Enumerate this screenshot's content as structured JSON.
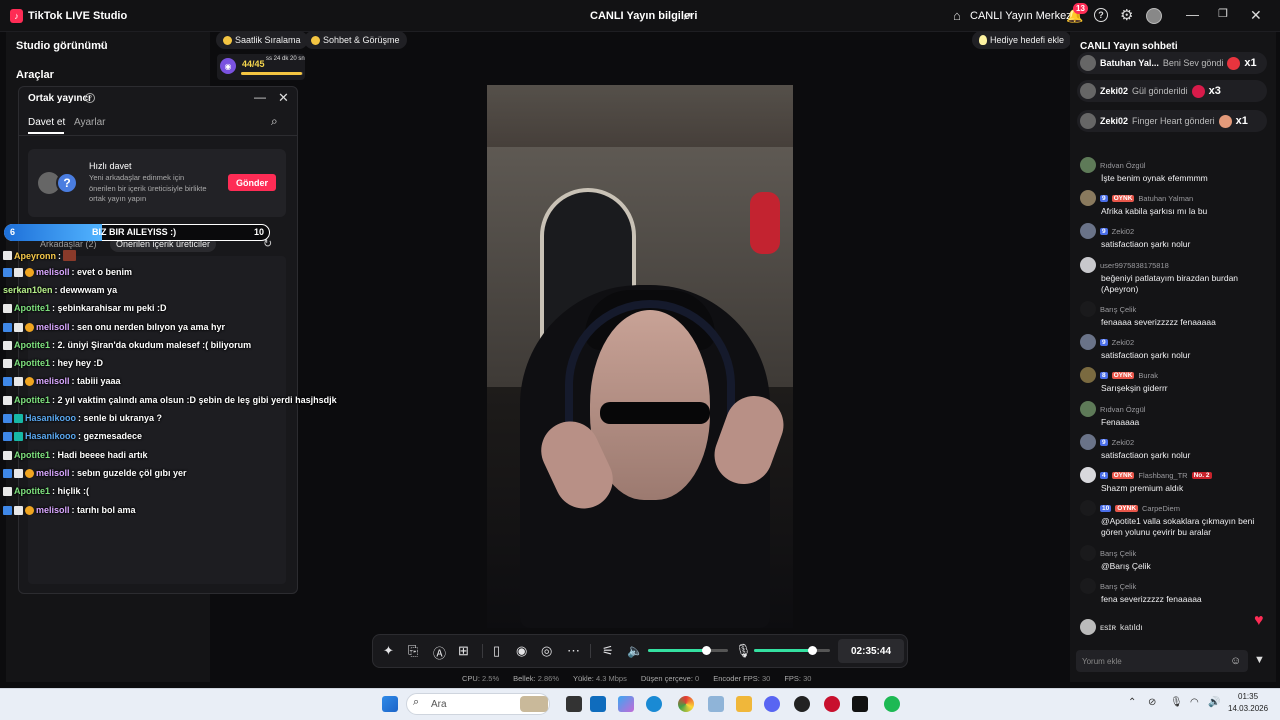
{
  "titlebar": {
    "app_title": "TikTok LIVE Studio",
    "live_info": "CANLI Yayın bilgileri",
    "live_center": "CANLI Yayın Merkezi",
    "notifications_count": "13"
  },
  "left": {
    "studio_view": "Studio görünümü",
    "tools": "Araçlar"
  },
  "pills": {
    "ranking": "Saatlik Sıralama",
    "chat_call": "Sohbet & Görüşme",
    "gift_goal": "Hediye hedefi ekle"
  },
  "goal": {
    "count": "44/45",
    "timer": "ss 24 dk 20 sn",
    "progress": 0.977
  },
  "cohost": {
    "title": "Ortak yayıncı",
    "tab_invite": "Davet et",
    "tab_settings": "Ayarlar",
    "quick_title": "Hızlı davet",
    "quick_desc": "Yeni arkadaşlar edinmek için önerilen bir içerik üreticisiyle birlikte ortak yayın yapın",
    "send": "Gönder",
    "friends_tab": "Arkadaşlar (2)",
    "suggested_tab": "Önerilen içerik üreticiler"
  },
  "score": {
    "left": "6",
    "team": "BIZ BIR AILEYISS :)",
    "right": "10",
    "left_share": 0.37
  },
  "overlay_chat": [
    {
      "name": "Apeyronn",
      "text": ":",
      "color": "gold",
      "badges": [
        "white"
      ],
      "flag": true
    },
    {
      "name": "melisoll",
      "text": ": evet o benim",
      "color": "pink",
      "badges": [
        "blue",
        "white",
        "orange"
      ]
    },
    {
      "name": "serkan10en",
      "text": ": dewwwam ya",
      "color": "lime",
      "badges": []
    },
    {
      "name": "Apotite1",
      "text": ": şebinkarahisar mı peki :D",
      "color": "green",
      "badges": [
        "white"
      ]
    },
    {
      "name": "melisoll",
      "text": ": sen onu nerden bılıyon ya ama hyr",
      "color": "pink",
      "badges": [
        "blue",
        "white",
        "orange"
      ]
    },
    {
      "name": "Apotite1",
      "text": ": 2. üniyi Şiran'da okudum malesef :( biliyorum",
      "color": "green",
      "badges": [
        "white"
      ]
    },
    {
      "name": "Apotite1",
      "text": ": hey hey :D",
      "color": "green",
      "badges": [
        "white"
      ]
    },
    {
      "name": "melisoll",
      "text": ": tabiii yaaa",
      "color": "pink",
      "badges": [
        "blue",
        "white",
        "orange"
      ]
    },
    {
      "name": "Apotite1",
      "text": ": 2 yıl vaktim çalındı ama olsun :D şebin de leş gibi yerdi hasjhsdjk",
      "color": "green",
      "badges": [
        "white"
      ]
    },
    {
      "name": "Hasanikooo",
      "text": ": senle bi ukranya ?",
      "color": "blue",
      "badges": [
        "blue",
        "teal"
      ]
    },
    {
      "name": "Hasanikooo",
      "text": ": gezmesadece",
      "color": "blue",
      "badges": [
        "blue",
        "teal"
      ]
    },
    {
      "name": "Apotite1",
      "text": ": Hadi beeee hadi artık",
      "color": "green",
      "badges": [
        "white"
      ]
    },
    {
      "name": "melisoll",
      "text": ": sebın guzelde çöl gıbı yer",
      "color": "pink",
      "badges": [
        "blue",
        "white",
        "orange"
      ]
    },
    {
      "name": "Apotite1",
      "text": ": hiçlik :(",
      "color": "green",
      "badges": [
        "white"
      ]
    },
    {
      "name": "melisoll",
      "text": ": tarıhı bol ama",
      "color": "pink",
      "badges": [
        "blue",
        "white",
        "orange"
      ]
    }
  ],
  "toolbar": {
    "timer": "02:35:44",
    "speaker_level": 0.73,
    "mic_level": 0.76
  },
  "stats": {
    "cpu_label": "CPU:",
    "cpu": "2.5%",
    "mem_label": "Bellek:",
    "mem": "2.86%",
    "upload_label": "Yükle:",
    "upload": "4.3 Mbps",
    "dropped_label": "Düşen çerçeve:",
    "dropped": "0",
    "encoder_label": "Encoder FPS:",
    "encoder": "30",
    "fps_label": "FPS:",
    "fps": "30"
  },
  "chat": {
    "title": "CANLI Yayın sohbeti",
    "gifts": [
      {
        "name": "Batuhan Yal...",
        "msg": "Beni Sev göndi",
        "mult": "x1",
        "color": "#e8343e"
      },
      {
        "name": "Zeki02",
        "msg": "Gül gönderildi",
        "mult": "x3",
        "color": "#d81b4a"
      },
      {
        "name": "Zeki02",
        "msg": "Finger Heart gönderi",
        "mult": "x1",
        "color": "#e39a7a"
      }
    ],
    "messages": [
      {
        "name": "Rıdvan Özgül",
        "text": "İşte benim oynak efemmmm",
        "lvl": "",
        "fan": "",
        "av": "#5e7a58"
      },
      {
        "name": "Batuhan Yalman",
        "text": "Afrika kabila şarkısı mı la bu",
        "lvl": "9",
        "fan": "OYNK",
        "av": "#8a7a5e"
      },
      {
        "name": "Zeki02",
        "text": "satisfactiaon şarkı nolur",
        "lvl": "9",
        "fan": "",
        "av": "#6a7388"
      },
      {
        "name": "user9975838175818",
        "text": "beğeniyi patlatayım birazdan burdan (Apeyron)",
        "lvl": "",
        "fan": "",
        "av": "#c8c8cc"
      },
      {
        "name": "Barış Çelik",
        "text": "fenaaaa severizzzzz fenaaaaa",
        "lvl": "",
        "fan": "",
        "av": "#1a1a1c"
      },
      {
        "name": "Zeki02",
        "text": "satisfactiaon şarkı nolur",
        "lvl": "9",
        "fan": "",
        "av": "#6a7388"
      },
      {
        "name": "Burak",
        "text": "Sarışekşin giderrr",
        "lvl": "8",
        "fan": "OYNK",
        "av": "#7a6a40"
      },
      {
        "name": "Rıdvan Özgül",
        "text": "Fenaaaaa",
        "lvl": "",
        "fan": "",
        "av": "#5e7a58"
      },
      {
        "name": "Zeki02",
        "text": "satisfactiaon şarkı nolur",
        "lvl": "9",
        "fan": "",
        "av": "#6a7388"
      },
      {
        "name": "Flashbang_TR",
        "text": "Shazm premium aldık",
        "lvl": "4",
        "fan": "OYNK",
        "no": "No. 2",
        "av": "#d8d8dc"
      },
      {
        "name": "CarpeDiem",
        "text": "@Apotite1 valla sokaklara çıkmayın beni gören yolunu çevirir bu aralar",
        "lvl": "10",
        "fan": "OYNK",
        "av": "#1a1a1c"
      },
      {
        "name": "Barış Çelik",
        "text": "@Barış Çelik",
        "lvl": "",
        "fan": "",
        "av": "#1a1a1c"
      },
      {
        "name": "Barış Çelik",
        "text": "fena severizzzzz fenaaaaa",
        "lvl": "",
        "fan": "",
        "av": "#1a1a1c"
      }
    ],
    "joined_name": "ᴇsɪ̇ʀ",
    "joined_text": "katıldı",
    "input_placeholder": "Yorum ekle"
  },
  "taskbar": {
    "search_placeholder": "Ara",
    "time": "01:35",
    "date": "14.03.2026"
  }
}
